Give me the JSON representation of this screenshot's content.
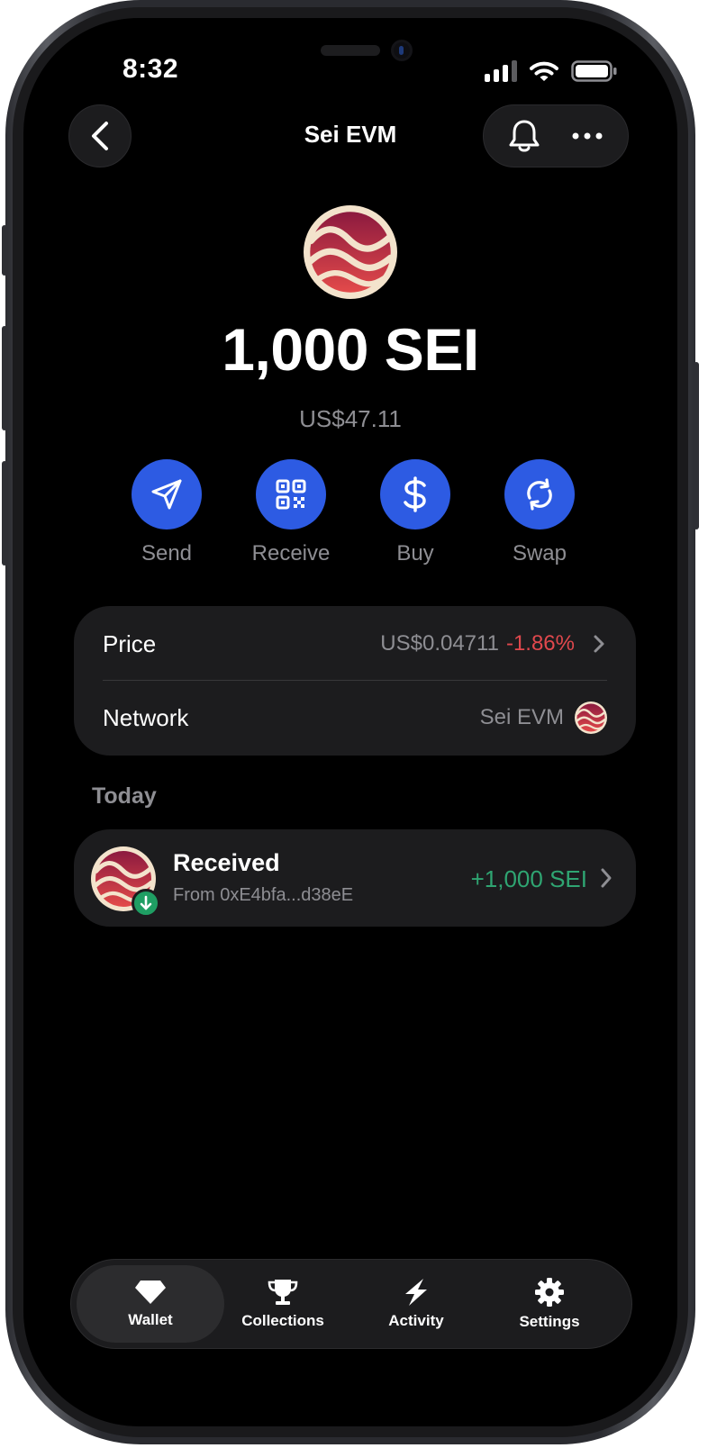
{
  "status_bar": {
    "time": "8:32"
  },
  "header": {
    "title": "Sei EVM"
  },
  "token": {
    "balance": "1,000 SEI",
    "fiat_value": "US$47.11"
  },
  "actions": [
    {
      "label": "Send",
      "icon": "send-icon"
    },
    {
      "label": "Receive",
      "icon": "qr-code-icon"
    },
    {
      "label": "Buy",
      "icon": "dollar-icon"
    },
    {
      "label": "Swap",
      "icon": "swap-icon"
    }
  ],
  "info": {
    "price_label": "Price",
    "price_value": "US$0.04711",
    "price_change": "-1.86%",
    "network_label": "Network",
    "network_value": "Sei EVM"
  },
  "activity": {
    "section_title": "Today",
    "transactions": [
      {
        "title": "Received",
        "subtitle": "From 0xE4bfa...d38eE",
        "amount": "+1,000 SEI"
      }
    ]
  },
  "tabbar": {
    "items": [
      {
        "label": "Wallet",
        "icon": "diamond-icon",
        "active": true
      },
      {
        "label": "Collections",
        "icon": "trophy-icon",
        "active": false
      },
      {
        "label": "Activity",
        "icon": "bolt-icon",
        "active": false
      },
      {
        "label": "Settings",
        "icon": "gear-icon",
        "active": false
      }
    ]
  },
  "colors": {
    "accent": "#2D5BE3",
    "negative": "#E0484D",
    "positive": "#2FA572",
    "card": "#1C1C1E",
    "sei_logo_dark": "#9B1B40",
    "sei_logo_light": "#F3E3CC"
  }
}
